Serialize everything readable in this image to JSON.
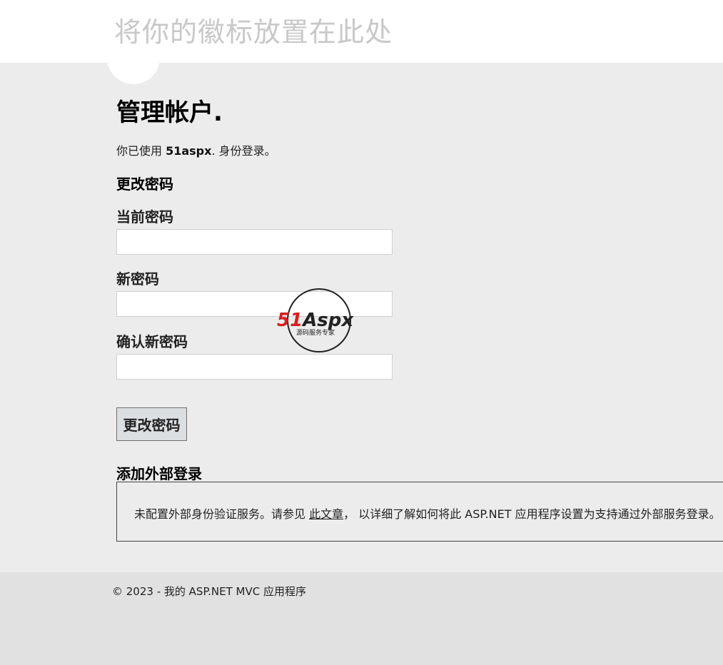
{
  "header": {
    "site_title": "将你的徽标放置在此处"
  },
  "main": {
    "page_title": "管理帐户.",
    "login_status": {
      "prefix": "你已使用 ",
      "username": "51aspx",
      "suffix": ". 身份登录。"
    },
    "change_password": {
      "heading": "更改密码",
      "current_password_label": "当前密码",
      "current_password_value": "",
      "new_password_label": "新密码",
      "new_password_value": "",
      "confirm_password_label": "确认新密码",
      "confirm_password_value": "",
      "submit_label": "更改密码"
    },
    "external_login": {
      "heading": "添加外部登录",
      "message_before": "未配置外部身份验证服务。请参见 ",
      "link_text": "此文章",
      "message_after": "， 以详细了解如何将此 ASP.NET 应用程序设置为支持通过外部服务登录。"
    }
  },
  "watermark": {
    "brand": "51Aspx",
    "brand_num": "51",
    "brand_text": "Aspx",
    "tagline": "源码服务专家",
    "colors": {
      "num": "#d42020",
      "text": "#222222",
      "x": "#2a9d3a"
    }
  },
  "footer": {
    "copyright": "© 2023 - 我的 ASP.NET MVC 应用程序"
  }
}
